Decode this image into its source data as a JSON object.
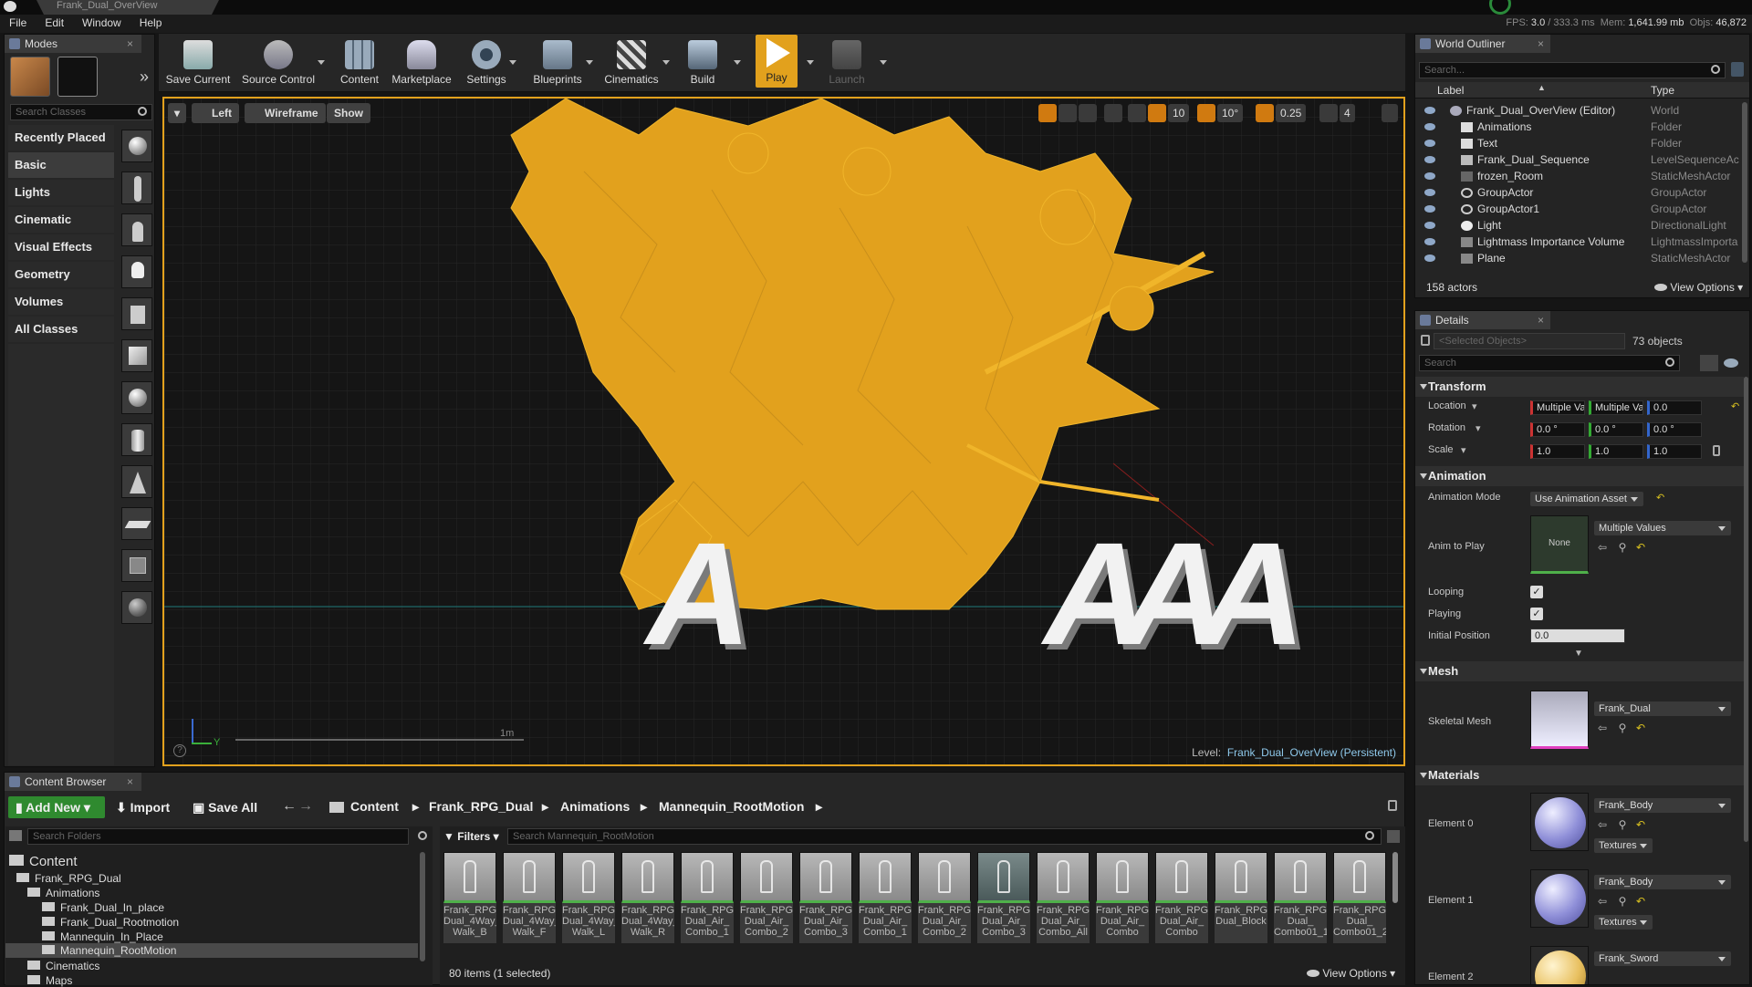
{
  "titlebar": {
    "doc_tab": "Frank_Dual_OverView"
  },
  "menu": {
    "items": [
      "File",
      "Edit",
      "Window",
      "Help"
    ]
  },
  "stats": {
    "fps_label": "FPS:",
    "fps": "3.0",
    "ms": "/ 333.3 ms",
    "mem_label": "Mem:",
    "mem": "1,641.99 mb",
    "objs_label": "Objs:",
    "objs": "46,872"
  },
  "modes": {
    "tab": "Modes",
    "search_placeholder": "Search Classes",
    "categories": [
      "Recently Placed",
      "Basic",
      "Lights",
      "Cinematic",
      "Visual Effects",
      "Geometry",
      "Volumes",
      "All Classes"
    ]
  },
  "toolbar": {
    "buttons": [
      "Save Current",
      "Source Control",
      "Content",
      "Marketplace",
      "Settings",
      "Blueprints",
      "Cinematics",
      "Build",
      "Play",
      "Launch"
    ]
  },
  "viewport": {
    "view_mode": "Left",
    "render_mode": "Wireframe",
    "show": "Show",
    "grid_snap": "10",
    "rot_snap": "10°",
    "scale_snap": "0.25",
    "cam_speed": "4",
    "scale_label": "1m",
    "level_label": "Level:",
    "level_name": "Frank_Dual_OverView (Persistent)",
    "text_left": "A",
    "text_right": "AAA",
    "axis_y": "Y"
  },
  "outliner": {
    "tab": "World Outliner",
    "search_placeholder": "Search...",
    "col_label": "Label",
    "col_type": "Type",
    "rows": [
      {
        "label": "Frank_Dual_OverView (Editor)",
        "type": "World"
      },
      {
        "label": "Animations",
        "type": "Folder"
      },
      {
        "label": "Text",
        "type": "Folder"
      },
      {
        "label": "Frank_Dual_Sequence",
        "type": "LevelSequenceAc"
      },
      {
        "label": "frozen_Room",
        "type": "StaticMeshActor"
      },
      {
        "label": "GroupActor",
        "type": "GroupActor"
      },
      {
        "label": "GroupActor1",
        "type": "GroupActor"
      },
      {
        "label": "Light",
        "type": "DirectionalLight"
      },
      {
        "label": "Lightmass Importance Volume",
        "type": "LightmassImporta"
      },
      {
        "label": "Plane",
        "type": "StaticMeshActor"
      }
    ],
    "actor_count": "158 actors",
    "view_options": "View Options"
  },
  "details": {
    "tab": "Details",
    "selected_placeholder": "<Selected Objects>",
    "selected_count": "73 objects",
    "search_placeholder": "Search",
    "transform": {
      "title": "Transform",
      "location_label": "Location",
      "location": [
        "Multiple Va",
        "Multiple Va",
        "0.0"
      ],
      "rotation_label": "Rotation",
      "rotation": [
        "0.0 °",
        "0.0 °",
        "0.0 °"
      ],
      "scale_label": "Scale",
      "scale": [
        "1.0",
        "1.0",
        "1.0"
      ]
    },
    "animation": {
      "title": "Animation",
      "mode_label": "Animation Mode",
      "mode_value": "Use Animation Asset",
      "anim_label": "Anim to Play",
      "anim_thumb": "None",
      "anim_value": "Multiple Values",
      "looping_label": "Looping",
      "playing_label": "Playing",
      "initial_label": "Initial Position",
      "initial_value": "0.0"
    },
    "mesh": {
      "title": "Mesh",
      "skeletal_label": "Skeletal Mesh",
      "skeletal_value": "Frank_Dual"
    },
    "materials": {
      "title": "Materials",
      "elements": [
        {
          "label": "Element 0",
          "value": "Frank_Body",
          "textures": "Textures",
          "color": "#8f8fd8"
        },
        {
          "label": "Element 1",
          "value": "Frank_Body",
          "textures": "Textures",
          "color": "#8f8fd8"
        },
        {
          "label": "Element 2",
          "value": "Frank_Sword",
          "textures": "",
          "color": "#e8c060"
        }
      ]
    }
  },
  "content_browser": {
    "tab": "Content Browser",
    "add_new": "Add New",
    "import": "Import",
    "save_all": "Save All",
    "breadcrumb": [
      "Content",
      "Frank_RPG_Dual",
      "Animations",
      "Mannequin_RootMotion"
    ],
    "folder_search_placeholder": "Search Folders",
    "filters": "Filters",
    "asset_search_placeholder": "Search Mannequin_RootMotion",
    "tree": [
      {
        "label": "Content",
        "level": 0
      },
      {
        "label": "Frank_RPG_Dual",
        "level": 1
      },
      {
        "label": "Animations",
        "level": 2
      },
      {
        "label": "Frank_Dual_In_place",
        "level": 3
      },
      {
        "label": "Frank_Dual_Rootmotion",
        "level": 3
      },
      {
        "label": "Mannequin_In_Place",
        "level": 3
      },
      {
        "label": "Mannequin_RootMotion",
        "level": 3
      },
      {
        "label": "Cinematics",
        "level": 2
      },
      {
        "label": "Maps",
        "level": 2
      }
    ],
    "assets": [
      "Frank_RPG_ Dual_4Way_ Walk_B",
      "Frank_RPG_ Dual_4Way_ Walk_F",
      "Frank_RPG_ Dual_4Way_ Walk_L",
      "Frank_RPG_ Dual_4Way_ Walk_R",
      "Frank_RPG_ Dual_Air_ Combo_1",
      "Frank_RPG_ Dual_Air_ Combo_2",
      "Frank_RPG_ Dual_Air_ Combo_3",
      "Frank_RPG_ Dual_Air_ Combo_1",
      "Frank_RPG_ Dual_Air_ Combo_2",
      "Frank_RPG_ Dual_Air_ Combo_3",
      "Frank_RPG_ Dual_Air_ Combo_All",
      "Frank_RPG_ Dual_Air_ Combo",
      "Frank_RPG_ Dual_Air_ Combo",
      "Frank_RPG_ Dual_Block",
      "Frank_RPG_ Dual_ Combo01_1",
      "Frank_RPG_ Dual_ Combo01_2"
    ],
    "status": "80 items (1 selected)",
    "view_options": "View Options"
  }
}
